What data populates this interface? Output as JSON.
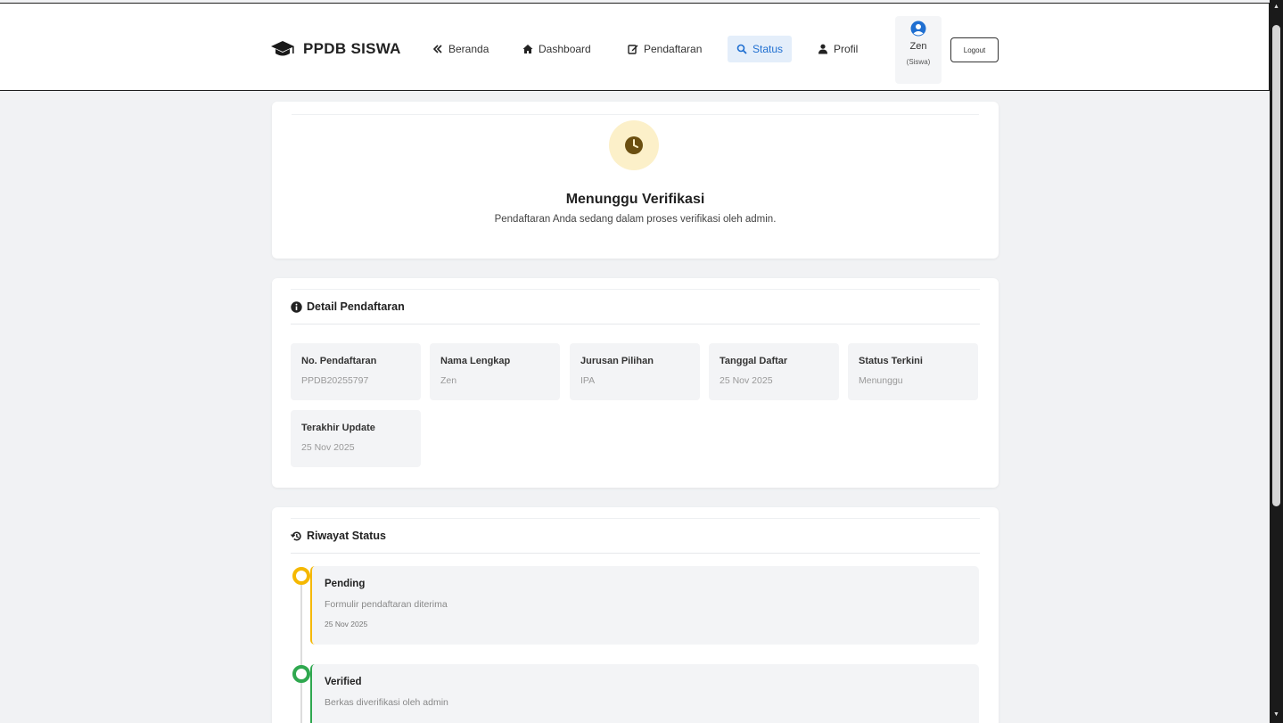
{
  "navbar": {
    "brand": "PPDB SISWA",
    "items": [
      {
        "label": "Beranda",
        "icon": "double-chevron-left-icon"
      },
      {
        "label": "Dashboard",
        "icon": "home-icon"
      },
      {
        "label": "Pendaftaran",
        "icon": "edit-icon"
      },
      {
        "label": "Status",
        "icon": "search-icon",
        "active": true
      },
      {
        "label": "Profil",
        "icon": "user-icon"
      }
    ],
    "user": {
      "name": "Zen",
      "role": "(Siswa)"
    },
    "logout_label": "Logout"
  },
  "status_card": {
    "title": "Menunggu Verifikasi",
    "description": "Pendaftaran Anda sedang dalam proses verifikasi oleh admin.",
    "icon": "clock-icon",
    "color": "#7a5a0c"
  },
  "detail": {
    "heading": "Detail Pendaftaran",
    "fields": [
      {
        "label": "No. Pendaftaran",
        "value": "PPDB20255797"
      },
      {
        "label": "Nama Lengkap",
        "value": "Zen"
      },
      {
        "label": "Jurusan Pilihan",
        "value": "IPA"
      },
      {
        "label": "Tanggal Daftar",
        "value": "25 Nov 2025"
      },
      {
        "label": "Status Terkini",
        "value": "Menunggu"
      },
      {
        "label": "Terakhir Update",
        "value": "25 Nov 2025"
      }
    ]
  },
  "history": {
    "heading": "Riwayat Status",
    "items": [
      {
        "title": "Pending",
        "desc": "Formulir pendaftaran diterima",
        "date": "25 Nov 2025",
        "color": "#f5b800"
      },
      {
        "title": "Verified",
        "desc": "Berkas diverifikasi oleh admin",
        "date": "",
        "color": "#2fa84f"
      }
    ]
  },
  "colors": {
    "accent": "#1f6fd1",
    "active_bg": "#e4eefa",
    "pending": "#f5b800",
    "verified": "#2fa84f"
  }
}
